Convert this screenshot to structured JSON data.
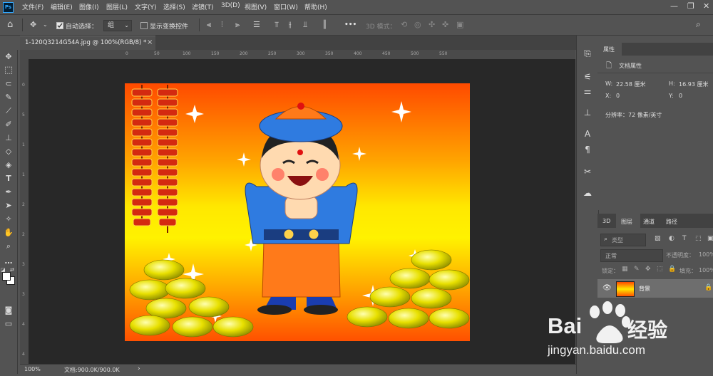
{
  "app": {
    "logo": "Ps"
  },
  "menu": [
    "文件(F)",
    "编辑(E)",
    "图像(I)",
    "图层(L)",
    "文字(Y)",
    "选择(S)",
    "滤镜(T)",
    "3D(D)",
    "视图(V)",
    "窗口(W)",
    "帮助(H)"
  ],
  "window_controls": {
    "minimize": "—",
    "restore": "❐",
    "close": "✕"
  },
  "options": {
    "auto_select_label": "自动选择：",
    "auto_select_checked": true,
    "auto_select_value": "组",
    "show_transform_label": "显示变换控件",
    "show_transform_checked": false,
    "more": "•••",
    "mode_3d_label": "3D 模式："
  },
  "document": {
    "tab_title": "1-120Q3214G54A.jpg @ 100%(RGB/8) *",
    "tab_close": "×"
  },
  "ruler": {
    "top_ticks": [
      "0",
      "50",
      "100",
      "150",
      "200",
      "250",
      "300",
      "350",
      "400",
      "450",
      "500",
      "550"
    ],
    "left_ticks": [
      "0",
      "5",
      "1",
      "1",
      "2",
      "2",
      "3",
      "3",
      "4",
      "4"
    ]
  },
  "status": {
    "zoom": "100%",
    "doc_info": "文档:900.0K/900.0K",
    "arrow": "›"
  },
  "properties": {
    "tab_label": "属性",
    "title": "文档属性",
    "w_label": "W:",
    "w_value": "22.58 厘米",
    "h_label": "H:",
    "h_value": "16.93 厘米",
    "x_label": "X:",
    "x_value": "0",
    "y_label": "Y:",
    "y_value": "0",
    "resolution": "分辨率：72 像素/英寸"
  },
  "layers_panel": {
    "tabs": [
      "3D",
      "图层",
      "通道",
      "路径"
    ],
    "active_tab": 1,
    "filter_label": "类型",
    "blend_mode": "正常",
    "opacity_label": "不透明度：",
    "opacity_value": "100%",
    "lock_label": "锁定：",
    "fill_label": "填充：",
    "fill_value": "100%",
    "layers": [
      {
        "name": "背景",
        "visible": true,
        "locked": true
      }
    ]
  },
  "watermark": {
    "brand": "Bai",
    "brand_cn": "经验",
    "url": "jingyan.baidu.com"
  },
  "colors": {
    "accent": "#31a8ff",
    "panel": "#535353",
    "dark": "#424242",
    "canvas": "#282828"
  }
}
